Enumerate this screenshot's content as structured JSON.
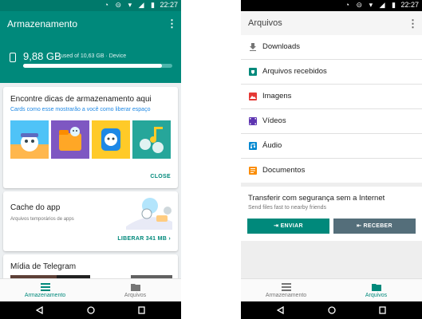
{
  "status": {
    "time": "22:27"
  },
  "left": {
    "title": "Armazenamento",
    "storage": {
      "used": "9,88 GB",
      "detail": "used of 10,63 GB · Device",
      "fraction": 0.93
    },
    "tips_card": {
      "title": "Encontre dicas de armazenamento aqui",
      "subtitle": "Cards como esse mostrarão a você como liberar espaço",
      "action": "CLOSE"
    },
    "cache_card": {
      "title": "Cache do app",
      "desc": "Arquivos temporários de apps",
      "action": "LIBERAR 341 MB"
    },
    "media_card": {
      "title": "Mídia de Telegram"
    },
    "nav": {
      "storage": "Armazenamento",
      "files": "Arquivos",
      "active": "storage"
    }
  },
  "right": {
    "title": "Arquivos",
    "items": [
      {
        "label": "Downloads",
        "icon": "download-icon",
        "color": "#757575"
      },
      {
        "label": "Arquivos recebidos",
        "icon": "received-files-icon",
        "color": "#00897b"
      },
      {
        "label": "Imagens",
        "icon": "image-icon",
        "color": "#e53935"
      },
      {
        "label": "Vídeos",
        "icon": "video-icon",
        "color": "#5e35b1"
      },
      {
        "label": "Áudio",
        "icon": "audio-icon",
        "color": "#0288d1"
      },
      {
        "label": "Documentos",
        "icon": "document-icon",
        "color": "#fb8c00"
      }
    ],
    "transfer": {
      "title": "Transferir com segurança sem a Internet",
      "subtitle": "Send files fast to nearby friends",
      "send": "ENVIAR",
      "receive": "RECEBER"
    },
    "nav": {
      "storage": "Armazenamento",
      "files": "Arquivos",
      "active": "files"
    }
  },
  "colors": {
    "teal": "#00897b",
    "teal_dark": "#00796b",
    "receive_button": "#546e7a"
  }
}
